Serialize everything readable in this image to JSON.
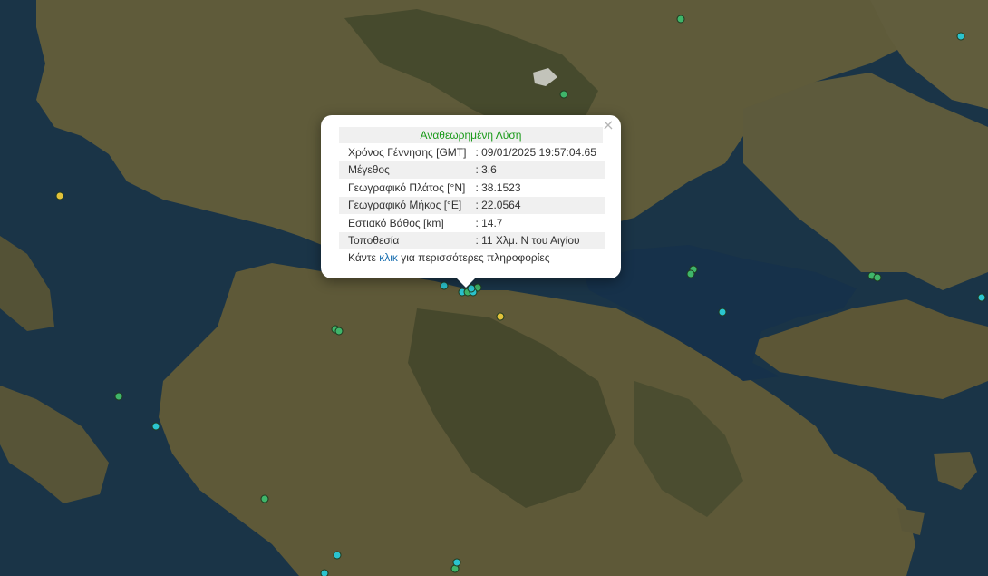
{
  "map": {
    "colors": {
      "sea": "#1a3447",
      "land": "#5e5a38",
      "mountain": "#3a4028",
      "marker_green": "#3fb56a",
      "marker_cyan": "#2bc4cf",
      "marker_yellow": "#e2c23a"
    },
    "markers": [
      {
        "color": "green"
      },
      {
        "color": "cyan"
      },
      {
        "color": "green"
      },
      {
        "color": "yellow"
      },
      {
        "color": "green"
      },
      {
        "color": "green"
      },
      {
        "color": "cyan"
      },
      {
        "color": "green"
      },
      {
        "color": "green"
      },
      {
        "color": "cyan"
      },
      {
        "color": "cyan"
      },
      {
        "color": "green"
      },
      {
        "color": "green"
      },
      {
        "color": "yellow"
      },
      {
        "color": "green"
      },
      {
        "color": "cyan"
      },
      {
        "color": "green"
      },
      {
        "color": "green"
      },
      {
        "color": "cyan"
      },
      {
        "color": "green"
      },
      {
        "color": "cyan"
      },
      {
        "color": "cyan"
      },
      {
        "color": "cyan"
      },
      {
        "color": "cyan"
      },
      {
        "color": "cyan"
      },
      {
        "color": "green"
      }
    ]
  },
  "popup": {
    "title": "Αναθεωρημένη Λύση",
    "close_symbol": "×",
    "rows": [
      {
        "label": "Χρόνος Γέννησης [GMT]",
        "value": ": 09/01/2025 19:57:04.65"
      },
      {
        "label": "Μέγεθος",
        "value": ": 3.6"
      },
      {
        "label": "Γεωγραφικό Πλάτος [°N]",
        "value": ": 38.1523"
      },
      {
        "label": "Γεωγραφικό Μήκος [°E]",
        "value": ": 22.0564"
      },
      {
        "label": "Εστιακό Βάθος [km]",
        "value": ": 14.7"
      },
      {
        "label": "Τοποθεσία",
        "value": ": 11 Χλμ. Ν του Αιγίου"
      }
    ],
    "more_prefix": "Κάντε ",
    "more_link": "κλικ",
    "more_suffix": " για περισσότερες πληροφορίες"
  }
}
